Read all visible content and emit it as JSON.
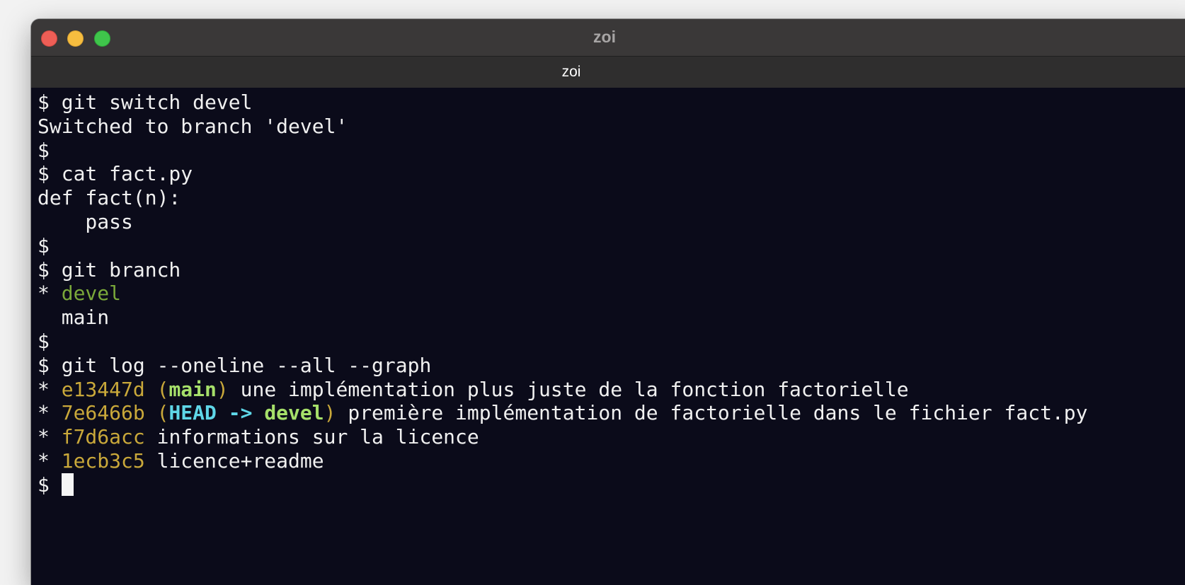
{
  "window": {
    "title": "zoi",
    "tab_title": "zoi"
  },
  "terminal": {
    "prompt": "$",
    "lines": {
      "l1": " git switch devel",
      "l2": "Switched to branch 'devel'",
      "l4": " cat fact.py",
      "l5": "def fact(n):",
      "l6": "    pass",
      "l8": " git branch",
      "l9_marker": "* ",
      "l9_branch": "devel",
      "l10": "  main",
      "l12": " git log --oneline --all --graph",
      "log": [
        {
          "graph": "* ",
          "hash": "e13447d",
          "ref_open": " (",
          "head": "",
          "arrow": "",
          "branch": "main",
          "ref_close": ")",
          "message": " une implémentation plus juste de la fonction factorielle"
        },
        {
          "graph": "* ",
          "hash": "7e6466b",
          "ref_open": " (",
          "head": "HEAD",
          "arrow": " -> ",
          "branch": "devel",
          "ref_close": ")",
          "message": " première implémentation de factorielle dans le fichier fact.py"
        },
        {
          "graph": "* ",
          "hash": "f7d6acc",
          "message": " informations sur la licence"
        },
        {
          "graph": "* ",
          "hash": "1ecb3c5",
          "message": " licence+readme"
        }
      ]
    },
    "colors": {
      "background": "#0b0b1a",
      "foreground": "#f0f0f0",
      "branch_current": "#7aa83a",
      "hash": "#c9a83a",
      "ref_branch": "#a6e06a",
      "ref_head": "#5fd7e8"
    }
  }
}
